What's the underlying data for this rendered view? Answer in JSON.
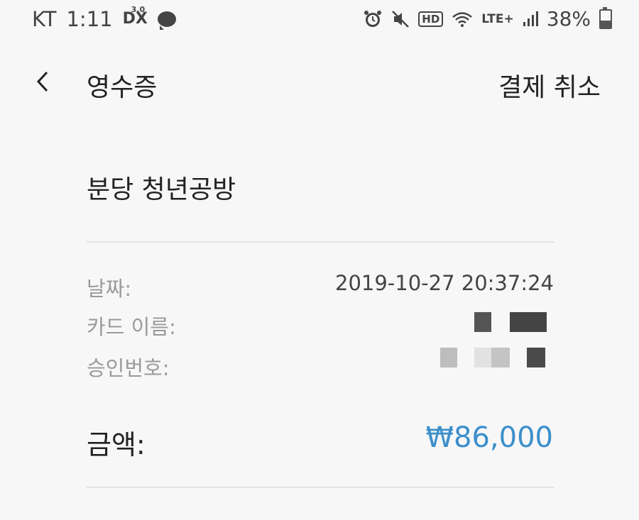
{
  "status_bar": {
    "carrier": "KT",
    "time": "1:11",
    "dx_label": "DX",
    "dx_version": "3.0",
    "hd_label": "HD",
    "lte_label": "LTE+",
    "battery": "38%"
  },
  "app_bar": {
    "title": "영수증",
    "cancel_label": "결제 취소"
  },
  "receipt": {
    "merchant": "분당 청년공방",
    "date_label": "날짜:",
    "date_value": "2019-10-27 20:37:24",
    "card_name_label": "카드 이름:",
    "approval_label": "승인번호:",
    "amount_label": "금액:",
    "amount_value": "₩86,000"
  },
  "colors": {
    "amount": "#3c8fcb",
    "label": "#9a9a9a",
    "text": "#222222"
  }
}
